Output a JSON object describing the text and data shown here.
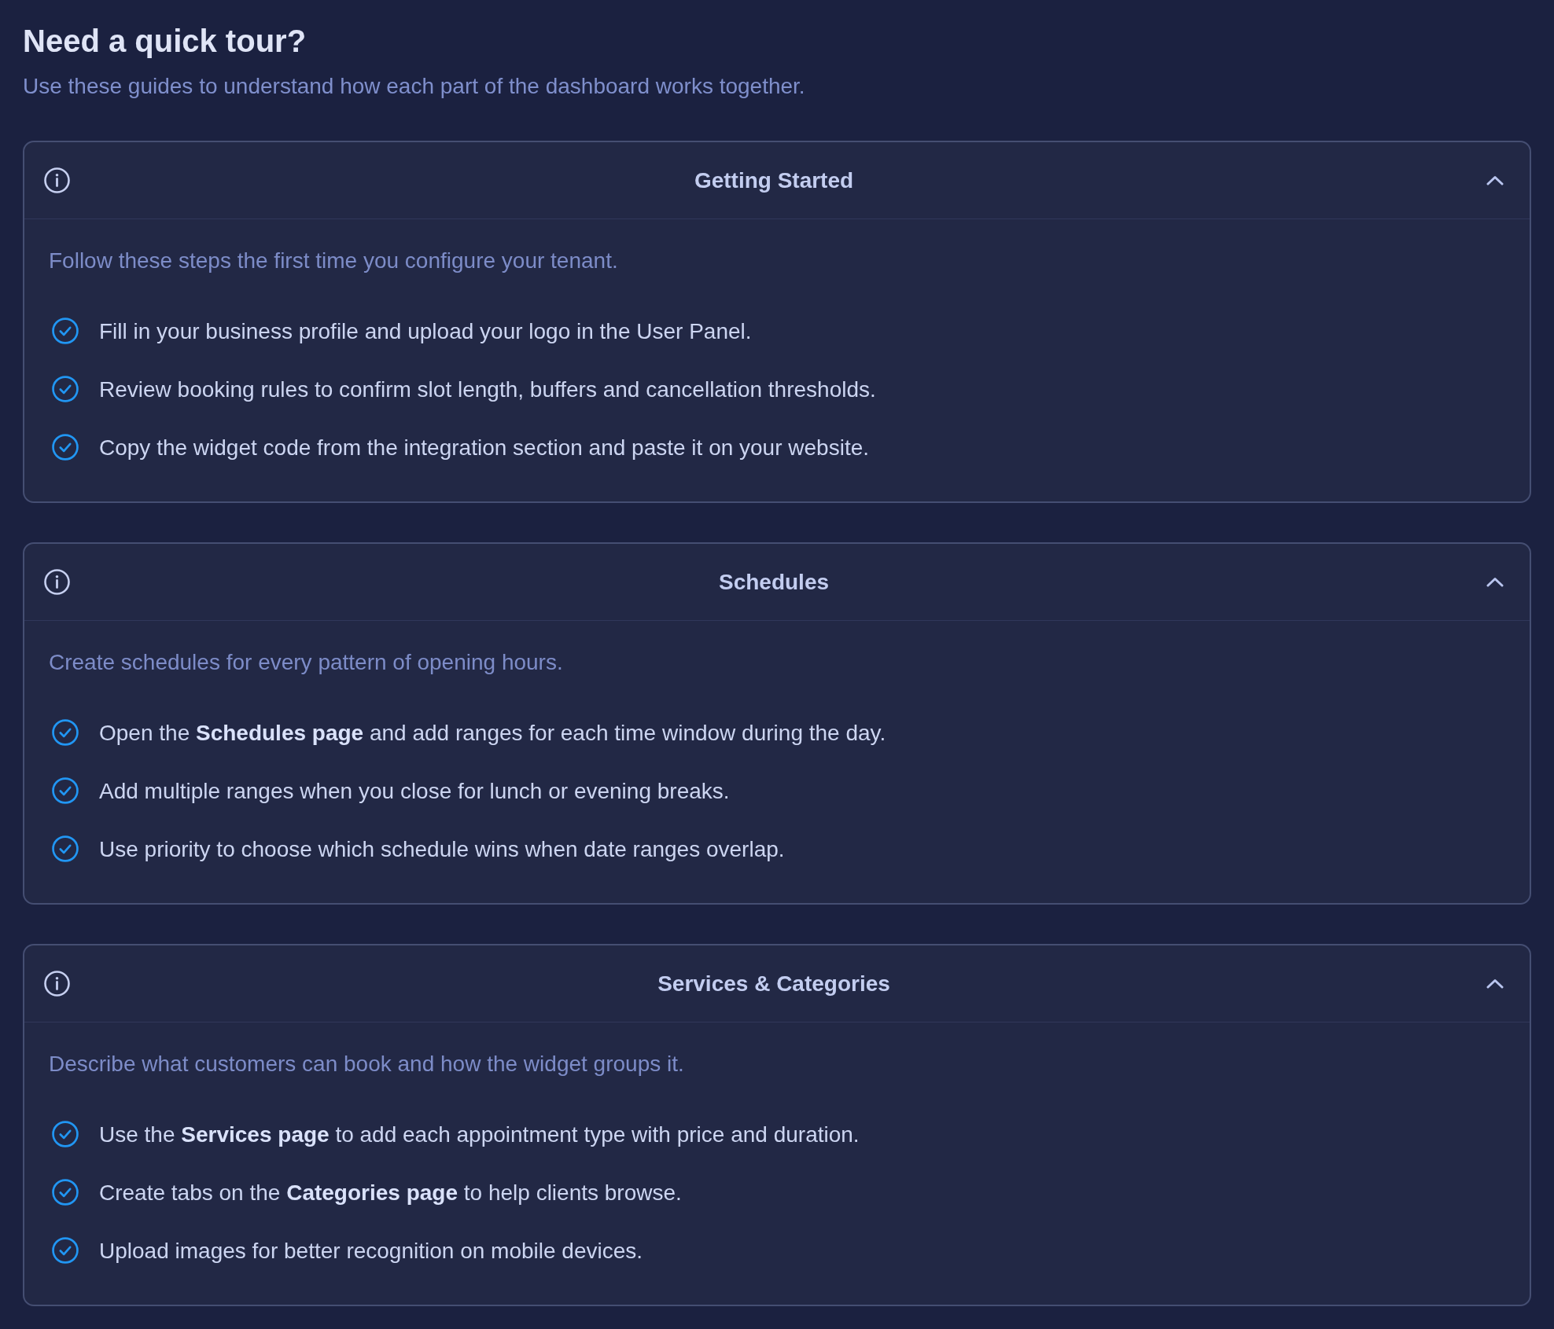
{
  "page": {
    "title": "Need a quick tour?",
    "subtitle": "Use these guides to understand how each part of the dashboard works together."
  },
  "sections": [
    {
      "title": "Getting Started",
      "expanded": true,
      "description": "Follow these steps the first time you configure your tenant.",
      "steps": [
        "Fill in your business profile and upload your logo in the User Panel.",
        "Review booking rules to confirm slot length, buffers and cancellation thresholds.",
        "Copy the widget code from the integration section and paste it on your website."
      ]
    },
    {
      "title": "Schedules",
      "expanded": true,
      "description": "Create schedules for every pattern of opening hours.",
      "steps": [
        "Open the **Schedules page** and add ranges for each time window during the day.",
        "Add multiple ranges when you close for lunch or evening breaks.",
        "Use priority to choose which schedule wins when date ranges overlap."
      ]
    },
    {
      "title": "Services & Categories",
      "expanded": true,
      "description": "Describe what customers can book and how the widget groups it.",
      "steps": [
        "Use the **Services page** to add each appointment type with price and duration.",
        "Create tabs on the **Categories page** to help clients browse.",
        "Upload images for better recognition on mobile devices."
      ]
    }
  ]
}
